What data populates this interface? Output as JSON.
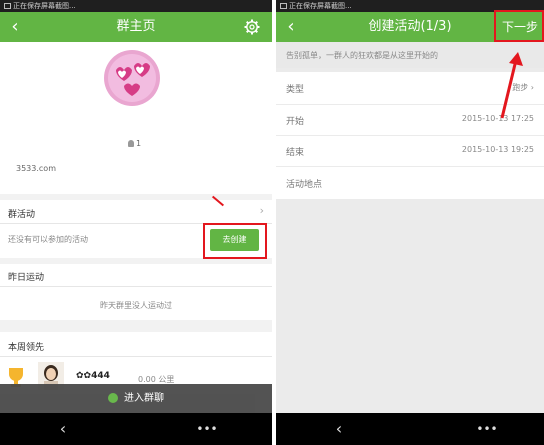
{
  "status_text": "正在保存屏幕截图...",
  "left": {
    "title": "群主页",
    "member_count": "1",
    "group_id": "3533.com",
    "activity_header": "群活动",
    "activity_empty": "还没有可以参加的活动",
    "create_button": "去创建",
    "yesterday_header": "昨日运动",
    "yesterday_empty": "昨天群里没人运动过",
    "week_header": "本周领先",
    "score": "444",
    "distance": "0.00 公里",
    "enter_chat": "进入群聊"
  },
  "right": {
    "title": "创建活动(1/3)",
    "next_button": "下一步",
    "slogan": "告别孤单，一群人的狂欢都是从这里开始的",
    "fields": [
      {
        "label": "类型",
        "value": "跑步"
      },
      {
        "label": "开始",
        "value": "2015-10-13 17:25"
      },
      {
        "label": "结束",
        "value": "2015-10-13 19:25"
      },
      {
        "label": "活动地点",
        "value": ""
      }
    ]
  },
  "colors": {
    "green": "#62b544",
    "red": "#e3171e",
    "bottom_bar": "#4a4a4a"
  },
  "icons": {
    "back": "chevron-left-icon",
    "settings": "gear-icon",
    "chat": "chat-bubble-icon",
    "menu": "more-dots-icon"
  }
}
